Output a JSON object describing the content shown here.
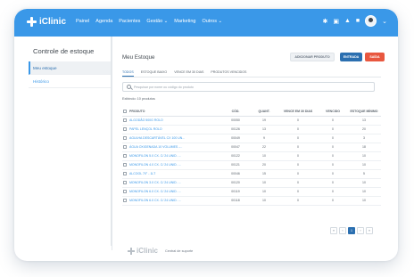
{
  "app": {
    "brand": "iClinic"
  },
  "nav": {
    "items": [
      "Painel",
      "Agenda",
      "Pacientes",
      "Gestão ⌄",
      "Marketing",
      "Outros ⌄"
    ]
  },
  "sidebar": {
    "title": "Controle de estoque",
    "items": [
      {
        "label": "Meu estoque",
        "active": true
      },
      {
        "label": "Histórico",
        "active": false
      }
    ]
  },
  "main": {
    "title": "Meu Estoque",
    "buttons": {
      "adjust": "ADICIONAR PRODUTO",
      "entry": "ENTRADA",
      "exit": "SAÍDA"
    },
    "tabs": [
      "TODOS",
      "ESTOQUE BAIXO",
      "VENCE EM 30 DIAS",
      "PRODUTOS VENCIDOS"
    ],
    "search_placeholder": "Pesquisar por nome ou código do produto",
    "count_text": "Exibindo: 10 produtos"
  },
  "table": {
    "headers": [
      "PRODUTO",
      "CÓD.",
      "QUANT.",
      "VENCE EM 30 DIAS",
      "VENCIDO",
      "ESTOQUE MÍNIMO"
    ],
    "rows": [
      [
        "ALGODÃO 500G ROLO",
        "00050",
        "19",
        "0",
        "0",
        "13"
      ],
      [
        "PAPEL LENÇOL ROLO",
        "00126",
        "13",
        "0",
        "0",
        "20"
      ],
      [
        "AGULHA DESCARTÁVEL CX 100 UN...",
        "00049",
        "9",
        "0",
        "0",
        "3"
      ],
      [
        "ÁGUA OXIGENADA 10 VOLUMES -...",
        "00047",
        "22",
        "0",
        "0",
        "18"
      ],
      [
        "MONOFILON 5.0 CX. C/ 24 UNID. ...",
        "00122",
        "10",
        "0",
        "0",
        "10"
      ],
      [
        "MONOFILON 4.0 CX. C/ 24 UNID. ...",
        "00121",
        "20",
        "0",
        "0",
        "10"
      ],
      [
        "ALCOOL 70° - 1LT",
        "00046",
        "15",
        "0",
        "0",
        "5"
      ],
      [
        "MONOFILON 3.0 CX. C/ 24 UNID. ...",
        "00120",
        "10",
        "0",
        "0",
        "10"
      ],
      [
        "MONOFILON 6.0 CX. C/ 24 UNID. ...",
        "00119",
        "10",
        "0",
        "0",
        "10"
      ],
      [
        "MONOFILON 6.0 CX. C/ 24 UNID. ...",
        "00118",
        "10",
        "0",
        "0",
        "10"
      ]
    ]
  },
  "pager": {
    "first": "«",
    "prev": "‹",
    "current": "1",
    "next": "›",
    "last": "»"
  },
  "footer": {
    "brand": "iClinic",
    "link": "Central de suporte"
  },
  "colors": {
    "accent": "#3a98e8",
    "primary_button": "#2b6fb0",
    "danger": "#e8573f"
  }
}
